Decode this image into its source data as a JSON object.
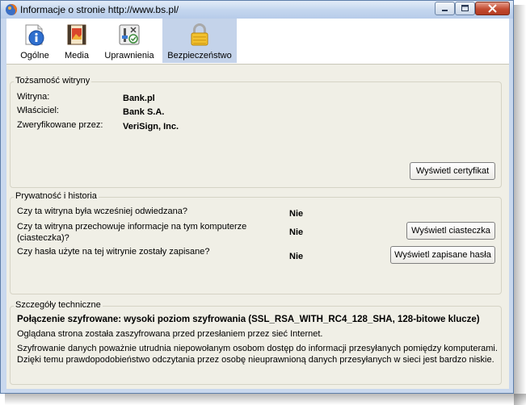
{
  "window": {
    "title": "Informacje o stronie http://www.bs.pl/"
  },
  "tabs": [
    {
      "label": "Ogólne",
      "icon": "general-info-icon"
    },
    {
      "label": "Media",
      "icon": "media-icon"
    },
    {
      "label": "Uprawnienia",
      "icon": "permissions-icon"
    },
    {
      "label": "Bezpieczeństwo",
      "icon": "padlock-icon",
      "active": true
    }
  ],
  "identity": {
    "legend": "Tożsamość witryny",
    "site_label": "Witryna:",
    "site_value": "Bank.pl",
    "owner_label": "Właściciel:",
    "owner_value": "Bank S.A.",
    "verified_label": "Zweryfikowane przez:",
    "verified_value": "VeriSign, Inc.",
    "cert_button": "Wyświetl certyfikat"
  },
  "privacy": {
    "legend": "Prywatność i historia",
    "q1": "Czy ta witryna była wcześniej odwiedzana?",
    "a1": "Nie",
    "q2_line1": "Czy ta witryna przechowuje informacje na tym komputerze",
    "q2_line2": "(ciasteczka)?",
    "a2": "Nie",
    "q3": "Czy hasła użyte na tej witrynie zostały zapisane?",
    "a3": "Nie",
    "cookies_button": "Wyświetl ciasteczka",
    "passwords_button": "Wyświetl zapisane hasła"
  },
  "technical": {
    "legend": "Szczegóły techniczne",
    "headline": "Połączenie szyfrowane: wysoki poziom szyfrowania (SSL_RSA_WITH_RC4_128_SHA, 128-bitowe klucze)",
    "line1": "Oglądana strona została zaszyfrowana przed przesłaniem przez sieć Internet.",
    "line2": "Szyfrowanie danych poważnie utrudnia niepowołanym osobom dostęp do informacji przesyłanych pomiędzy komputerami.",
    "line3": "Dzięki temu prawdopodobieństwo odczytania przez osobę nieuprawnioną danych przesyłanych w sieci jest bardzo niskie."
  },
  "colors": {
    "active_tab": "#c4d3ea",
    "dialog_bg": "#f0efe6",
    "close_button": "#c24a30"
  }
}
